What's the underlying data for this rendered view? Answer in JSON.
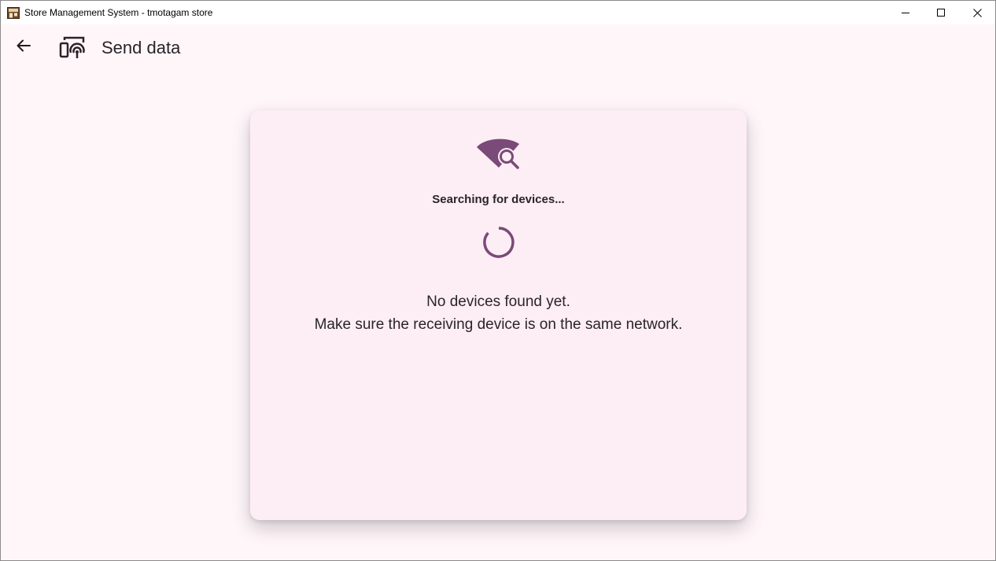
{
  "window": {
    "title": "Store Management System - tmotagam store",
    "icon": "store-icon",
    "controls": [
      "minimize-icon",
      "maximize-icon",
      "close-icon"
    ]
  },
  "appbar": {
    "back_icon": "arrow-left-icon",
    "page_icon": "device-broadcast-icon",
    "title": "Send data"
  },
  "card": {
    "icon": "wifi-search-icon",
    "status": "Searching for devices...",
    "empty_line1": "No devices found yet.",
    "empty_line2": "Make sure the receiving device is on the same network."
  },
  "colors": {
    "accent": "#7a4a78",
    "background": "#fff6fa",
    "card": "#fdeef5"
  }
}
